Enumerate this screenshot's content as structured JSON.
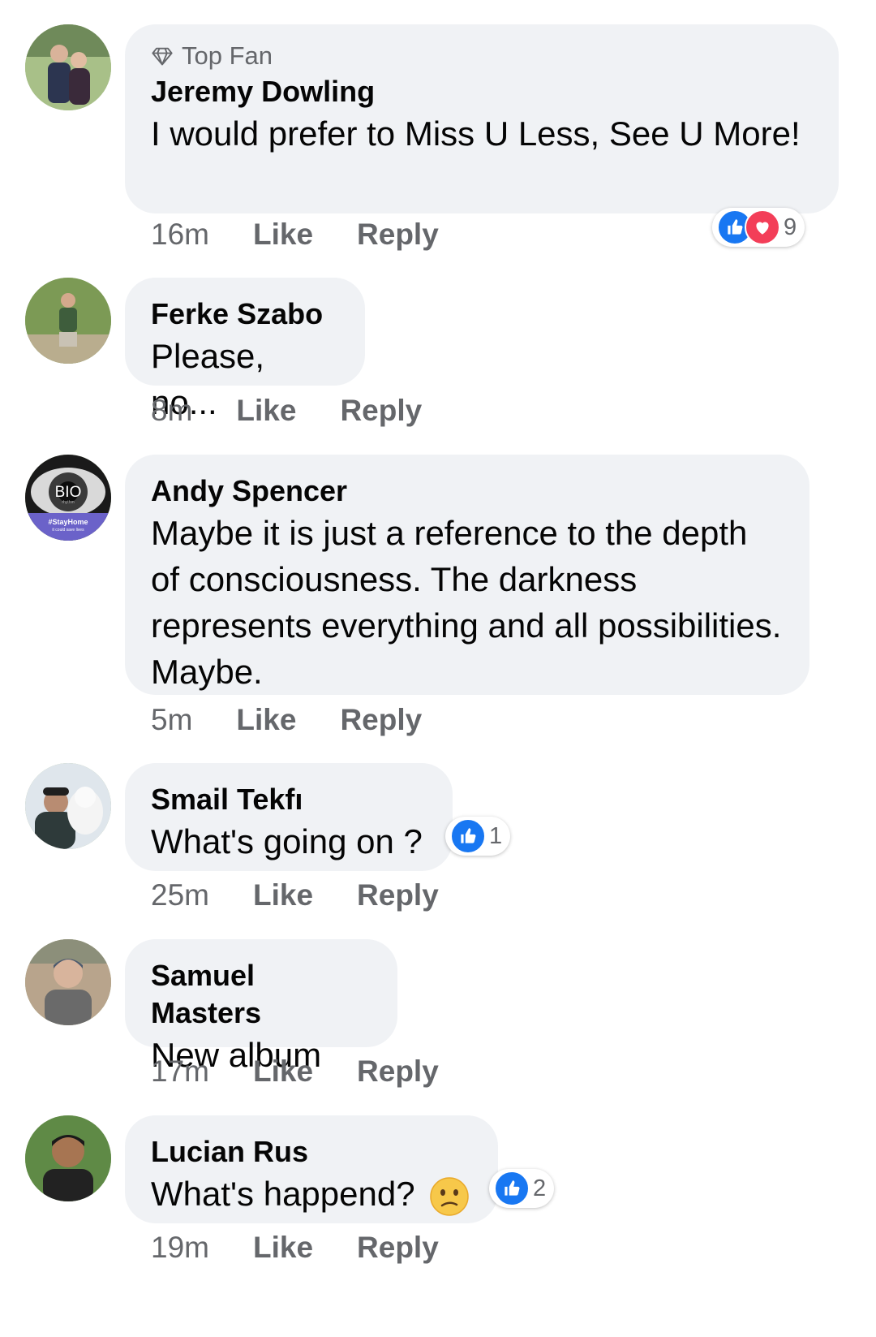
{
  "comments": [
    {
      "badge": "Top Fan",
      "name": "Jeremy Dowling",
      "text": "I would prefer to Miss U Less, See U More!",
      "time": "16m",
      "like": "Like",
      "reply": "Reply",
      "reactions": {
        "types": [
          "like",
          "love"
        ],
        "count": "9"
      }
    },
    {
      "name": "Ferke Szabo",
      "text": "Please, no...",
      "time": "8m",
      "like": "Like",
      "reply": "Reply"
    },
    {
      "name": "Andy Spencer",
      "text": "Maybe it is just a reference to the depth of consciousness. The darkness represents everything and all possibilities. Maybe.",
      "time": "5m",
      "like": "Like",
      "reply": "Reply",
      "avatar_text": {
        "bio": "BIO",
        "sub": "rhythm",
        "tag": "#StayHome",
        "tag2": "it could save lives"
      }
    },
    {
      "name": "Smail Tekfı",
      "text": "What's going on ?",
      "time": "25m",
      "like": "Like",
      "reply": "Reply",
      "reactions": {
        "types": [
          "like"
        ],
        "count": "1"
      }
    },
    {
      "name": "Samuel Masters",
      "text": "New album",
      "time": "17m",
      "like": "Like",
      "reply": "Reply"
    },
    {
      "name": "Lucian Rus",
      "text": "What's happend?",
      "emoji": "confused-face-emoji",
      "time": "19m",
      "like": "Like",
      "reply": "Reply",
      "reactions": {
        "types": [
          "like"
        ],
        "count": "2"
      }
    }
  ],
  "icons": {
    "top_fan": "diamond-icon",
    "like_reaction": "thumbs-up-icon",
    "love_reaction": "heart-icon"
  },
  "colors": {
    "bubble": "#f0f2f5",
    "meta": "#65676b",
    "like_blue": "#1877f2",
    "love_red": "#f33e58"
  }
}
